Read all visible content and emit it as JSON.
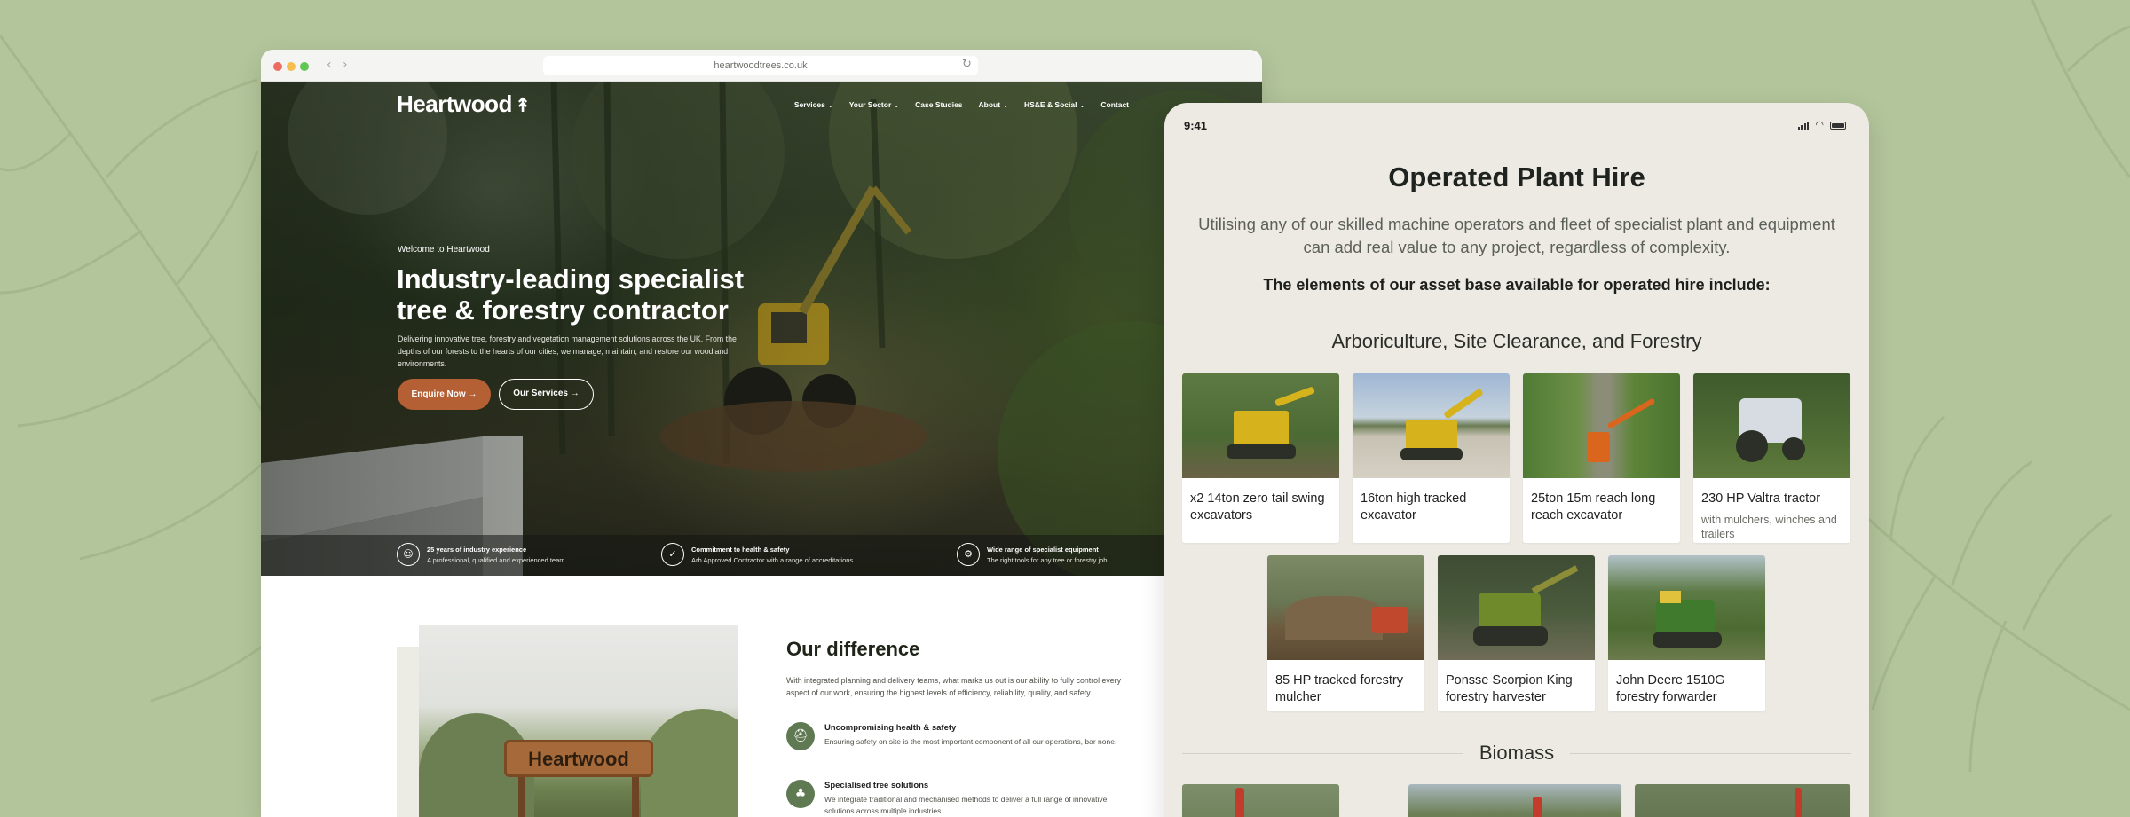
{
  "colors": {
    "background": "#b3c59b",
    "accent": "#b45f34",
    "icon_green": "#5f7a52",
    "tablet_bg": "#edeae3"
  },
  "browser": {
    "url": "heartwoodtrees.co.uk",
    "back_icon": "chevron-left-icon",
    "forward_icon": "chevron-right-icon",
    "reload_icon": "reload-icon"
  },
  "site": {
    "logo": "Heartwood",
    "nav": [
      {
        "label": "Services",
        "dropdown": true
      },
      {
        "label": "Your Sector",
        "dropdown": true
      },
      {
        "label": "Case Studies",
        "dropdown": false
      },
      {
        "label": "About",
        "dropdown": true
      },
      {
        "label": "HS&E & Social",
        "dropdown": true
      },
      {
        "label": "Contact",
        "dropdown": false
      }
    ],
    "hero": {
      "eyebrow": "Welcome to Heartwood",
      "title": "Industry-leading specialist tree & forestry contractor",
      "description": "Delivering innovative tree, forestry and vegetation management solutions across the UK. From the depths of our forests to the hearts of our cities, we manage, maintain, and restore our woodland environments.",
      "cta_primary": "Enquire Now →",
      "cta_secondary": "Our Services →"
    },
    "features": [
      {
        "icon": "people-icon",
        "title": "25 years of industry experience",
        "subtitle": "A professional, qualified and experienced team"
      },
      {
        "icon": "shield-icon",
        "title": "Commitment to health & safety",
        "subtitle": "Arb Approved Contractor with a range of accreditations"
      },
      {
        "icon": "gear-icon",
        "title": "Wide range of specialist equipment",
        "subtitle": "The right tools for any tree or forestry job"
      }
    ],
    "photo_sign": "Heartwood",
    "difference": {
      "title": "Our difference",
      "text": "With integrated planning and delivery teams, what marks us out is our ability to fully control every aspect of our work, ensuring the highest levels of efficiency, reliability, quality, and safety.",
      "items": [
        {
          "icon": "helmet-icon",
          "title": "Uncompromising health & safety",
          "text": "Ensuring safety on site is the most important component of all our operations, bar none."
        },
        {
          "icon": "tree-icon",
          "title": "Specialised tree solutions",
          "text": "We integrate traditional and mechanised methods to deliver a full range of innovative solutions across multiple industries."
        }
      ]
    }
  },
  "tablet": {
    "time": "9:41",
    "title": "Operated Plant Hire",
    "intro": "Utilising any of our skilled machine operators and fleet of specialist plant and equipment can add real value to any project, regardless of complexity.",
    "lead": "The elements of our asset base available for operated hire include:",
    "sections": [
      {
        "heading": "Arboriculture, Site Clearance, and Forestry",
        "items": [
          {
            "label": "x2 14ton zero tail swing excavators",
            "sub": ""
          },
          {
            "label": "16ton high tracked excavator",
            "sub": ""
          },
          {
            "label": "25ton 15m reach long reach excavator",
            "sub": ""
          },
          {
            "label": "230 HP Valtra tractor",
            "sub": "with mulchers, winches and trailers"
          },
          {
            "label": "85 HP tracked forestry mulcher",
            "sub": ""
          },
          {
            "label": "Ponsse Scorpion King forestry harvester",
            "sub": ""
          },
          {
            "label": "John Deere 1510G forestry forwarder",
            "sub": ""
          }
        ]
      },
      {
        "heading": "Biomass",
        "items": []
      }
    ]
  }
}
